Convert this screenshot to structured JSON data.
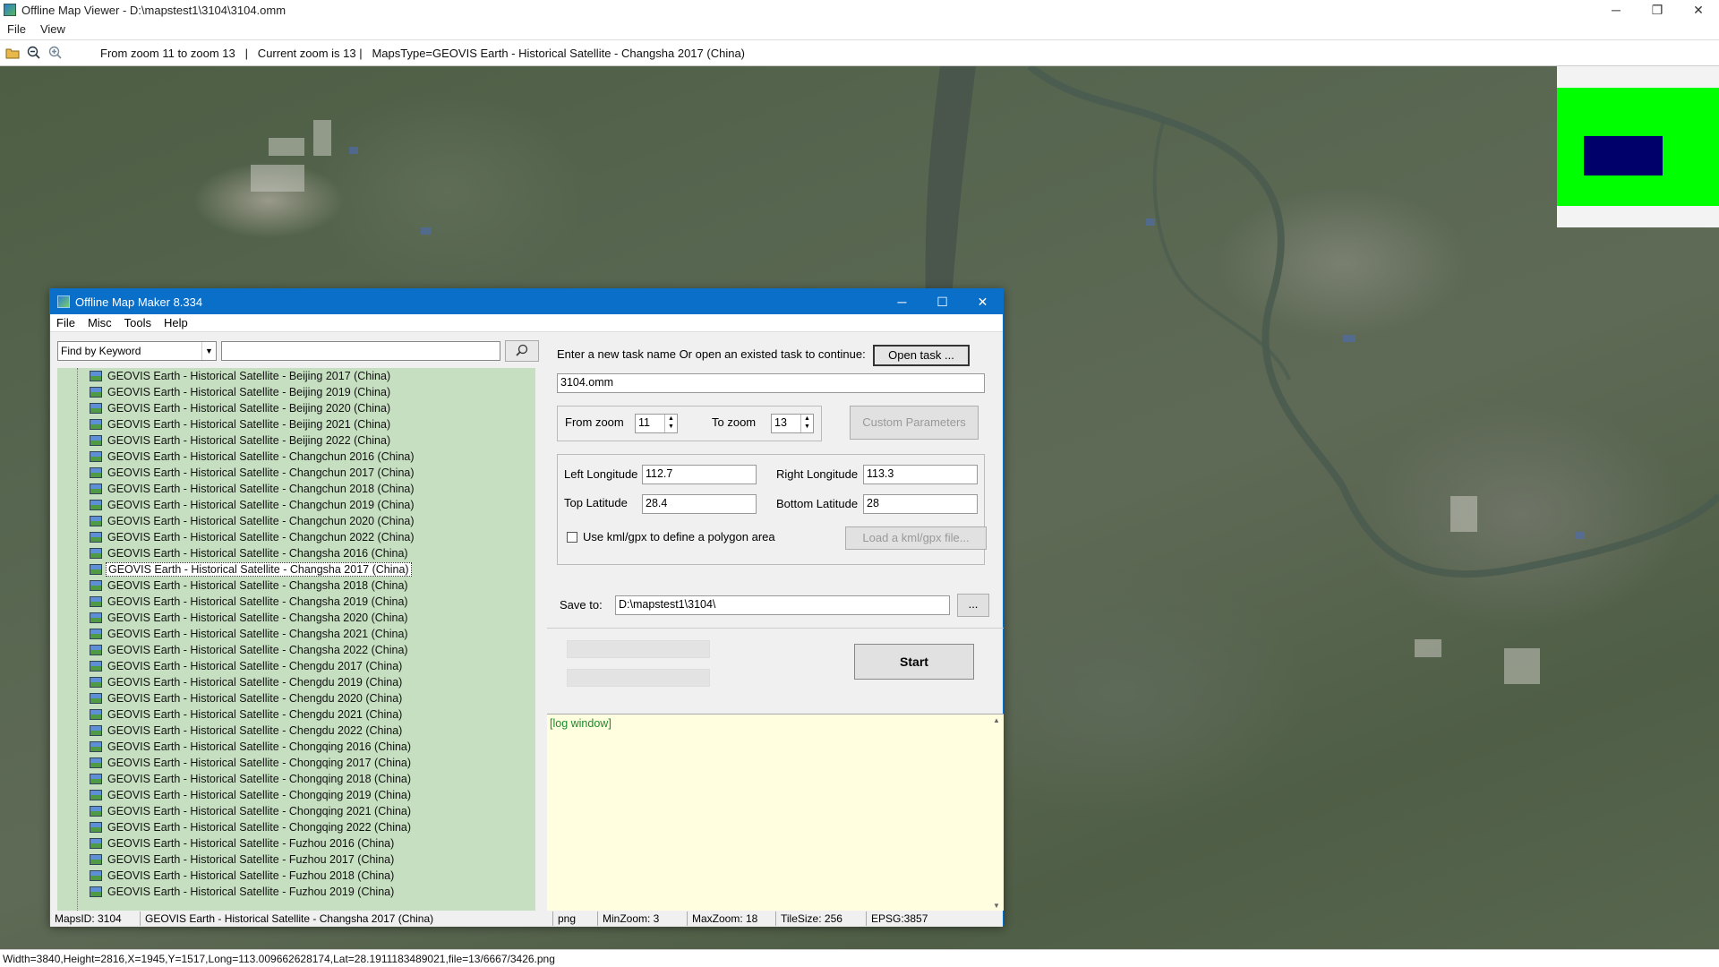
{
  "window": {
    "title": "Offline Map Viewer - D:\\mapstest1\\3104\\3104.omm",
    "controls": {
      "minimize": "─",
      "maximize": "❐",
      "close": "✕"
    }
  },
  "menubar": [
    "File",
    "View"
  ],
  "toolbar": {
    "info": "From zoom 11 to zoom 13   |   Current zoom is 13 |   MapsType=GEOVIS Earth - Historical Satellite - Changsha 2017 (China)"
  },
  "statusbar": {
    "text": "Width=3840,Height=2816,X=1945,Y=1517,Long=113.009662628174,Lat=28.1911183489021,file=13/6667/3426.png"
  },
  "colors": {
    "accent": "#0a6fc8",
    "tree_bg": "#c6dfc0",
    "log_bg": "#ffffe0",
    "log_text": "#1c8a2a",
    "minimap_green": "#00ff00",
    "minimap_view": "#00006b"
  },
  "dialog": {
    "title": "Offline Map Maker 8.334",
    "controls": {
      "minimize": "─",
      "maximize": "☐",
      "close": "✕"
    },
    "menu": [
      "File",
      "Misc",
      "Tools",
      "Help"
    ],
    "find": {
      "mode": "Find by Keyword",
      "value": ""
    },
    "tree": {
      "selected_index": 12,
      "items": [
        "GEOVIS Earth - Historical Satellite - Beijing 2017 (China)",
        "GEOVIS Earth - Historical Satellite - Beijing 2019 (China)",
        "GEOVIS Earth - Historical Satellite - Beijing 2020 (China)",
        "GEOVIS Earth - Historical Satellite - Beijing 2021 (China)",
        "GEOVIS Earth - Historical Satellite - Beijing 2022 (China)",
        "GEOVIS Earth - Historical Satellite - Changchun 2016 (China)",
        "GEOVIS Earth - Historical Satellite - Changchun 2017 (China)",
        "GEOVIS Earth - Historical Satellite - Changchun 2018 (China)",
        "GEOVIS Earth - Historical Satellite - Changchun 2019 (China)",
        "GEOVIS Earth - Historical Satellite - Changchun 2020 (China)",
        "GEOVIS Earth - Historical Satellite - Changchun 2022 (China)",
        "GEOVIS Earth - Historical Satellite - Changsha 2016 (China)",
        "GEOVIS Earth - Historical Satellite - Changsha 2017 (China)",
        "GEOVIS Earth - Historical Satellite - Changsha 2018 (China)",
        "GEOVIS Earth - Historical Satellite - Changsha 2019 (China)",
        "GEOVIS Earth - Historical Satellite - Changsha 2020 (China)",
        "GEOVIS Earth - Historical Satellite - Changsha 2021 (China)",
        "GEOVIS Earth - Historical Satellite - Changsha 2022 (China)",
        "GEOVIS Earth - Historical Satellite - Chengdu 2017 (China)",
        "GEOVIS Earth - Historical Satellite - Chengdu 2019 (China)",
        "GEOVIS Earth - Historical Satellite - Chengdu 2020 (China)",
        "GEOVIS Earth - Historical Satellite - Chengdu 2021 (China)",
        "GEOVIS Earth - Historical Satellite - Chengdu 2022 (China)",
        "GEOVIS Earth - Historical Satellite - Chongqing 2016 (China)",
        "GEOVIS Earth - Historical Satellite - Chongqing 2017 (China)",
        "GEOVIS Earth - Historical Satellite - Chongqing 2018 (China)",
        "GEOVIS Earth - Historical Satellite - Chongqing 2019 (China)",
        "GEOVIS Earth - Historical Satellite - Chongqing 2021 (China)",
        "GEOVIS Earth - Historical Satellite - Chongqing 2022 (China)",
        "GEOVIS Earth - Historical Satellite - Fuzhou 2016 (China)",
        "GEOVIS Earth - Historical Satellite - Fuzhou 2017 (China)",
        "GEOVIS Earth - Historical Satellite - Fuzhou 2018 (China)",
        "GEOVIS Earth - Historical Satellite - Fuzhou 2019 (China)"
      ]
    },
    "task": {
      "prompt": "Enter a new task name Or open an existed task to continue:",
      "open_button": "Open task ...",
      "name": "3104.omm"
    },
    "zoom": {
      "from_label": "From zoom",
      "from_value": "11",
      "to_label": "To zoom",
      "to_value": "13",
      "custom_button": "Custom Parameters"
    },
    "bounds": {
      "left_lon_label": "Left Longitude",
      "left_lon": "112.7",
      "right_lon_label": "Right Longitude",
      "right_lon": "113.3",
      "top_lat_label": "Top Latitude",
      "top_lat": "28.4",
      "bottom_lat_label": "Bottom Latitude",
      "bottom_lat": "28",
      "kml_label": "Use kml/gpx to define a polygon area",
      "kml_button": "Load a kml/gpx file..."
    },
    "save": {
      "label": "Save to:",
      "path": "D:\\mapstest1\\3104\\",
      "browse": "..."
    },
    "start_button": "Start",
    "log": "[log window]",
    "status": {
      "maps_id": "MapsID: 3104",
      "map_name": "GEOVIS Earth - Historical Satellite - Changsha 2017 (China)",
      "format": "png",
      "min_zoom": "MinZoom: 3",
      "max_zoom": "MaxZoom: 18",
      "tile_size": "TileSize: 256",
      "epsg": "EPSG:3857"
    }
  }
}
